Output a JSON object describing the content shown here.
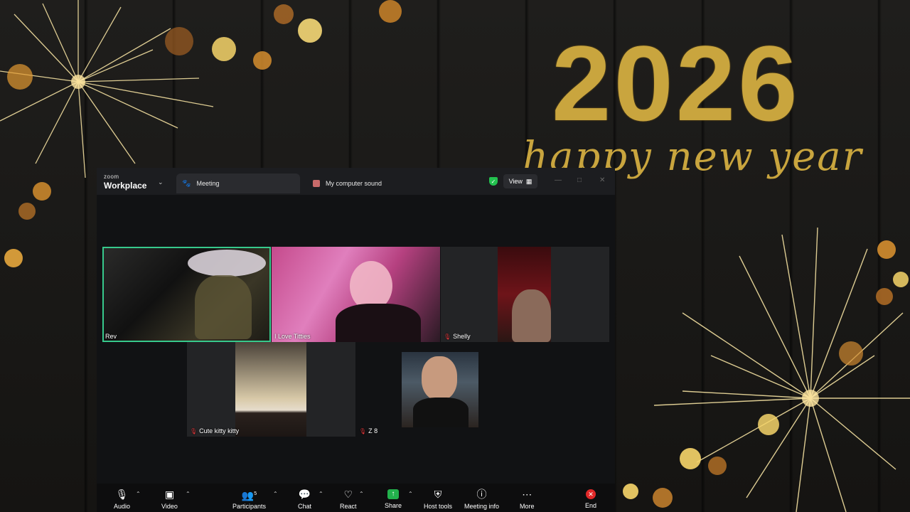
{
  "background": {
    "year": "2026",
    "greeting": "happy new year",
    "accent": "#c9a53e"
  },
  "window": {
    "brand_small": "zoom",
    "brand_big": "Workplace",
    "tabs": [
      {
        "label": "Meeting",
        "icon": "paw-icon"
      },
      {
        "label": "My computer sound",
        "icon": "speaker-icon"
      }
    ],
    "view_label": "View"
  },
  "participants": [
    {
      "name": "Rev",
      "muted": false,
      "active_speaker": true
    },
    {
      "name": "I Love Titties",
      "muted": false
    },
    {
      "name": "Shelly",
      "muted": true
    },
    {
      "name": "Cute kitty kitty",
      "muted": true
    },
    {
      "name": "Z 8",
      "muted": true
    },
    {
      "name": "",
      "muted": false
    }
  ],
  "toolbar": {
    "audio": "Audio",
    "video": "Video",
    "participants": "Participants",
    "participants_count": "5",
    "chat": "Chat",
    "react": "React",
    "share": "Share",
    "host_tools": "Host tools",
    "meeting_info": "Meeting info",
    "more": "More",
    "end": "End"
  },
  "colors": {
    "speaker_border": "#37c98c",
    "share_green": "#22b14c",
    "end_red": "#e02828",
    "shield_green": "#23c14f"
  }
}
